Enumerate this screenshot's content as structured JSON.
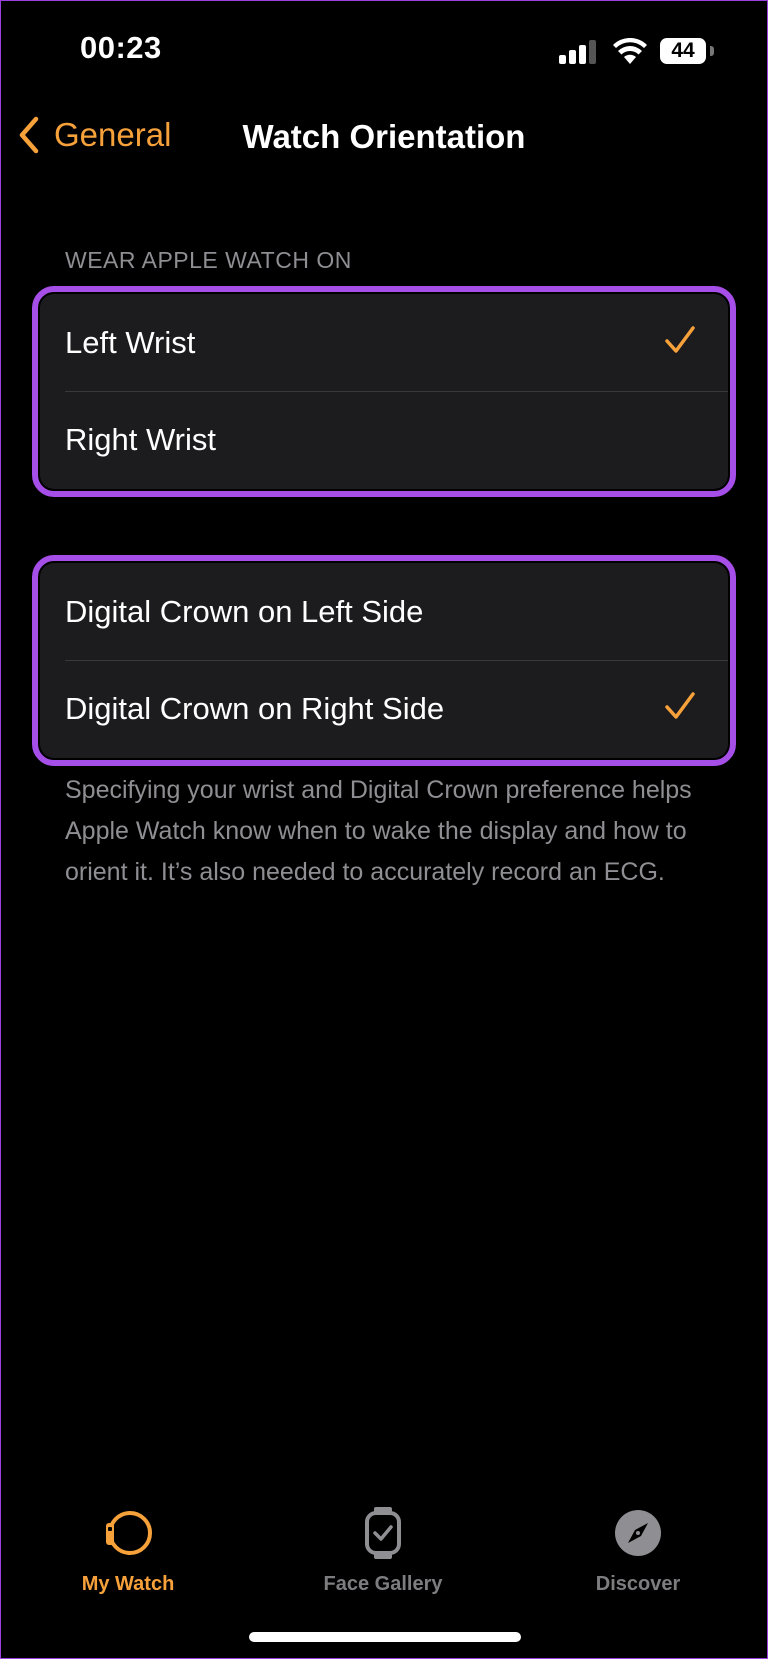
{
  "status_bar": {
    "time": "00:23",
    "battery": "44"
  },
  "nav": {
    "back_label": "General",
    "title": "Watch Orientation"
  },
  "section_header": "WEAR APPLE WATCH ON",
  "wrist_group": [
    {
      "label": "Left Wrist",
      "checked": true
    },
    {
      "label": "Right Wrist",
      "checked": false
    }
  ],
  "crown_group": [
    {
      "label": "Digital Crown on Left Side",
      "checked": false
    },
    {
      "label": "Digital Crown on Right Side",
      "checked": true
    }
  ],
  "footer": "Specifying your wrist and Digital Crown preference helps Apple Watch know when to wake the display and how to orient it. It’s also needed to accurately record an ECG.",
  "tabs": [
    {
      "label": "My Watch",
      "icon": "watch-icon",
      "active": true
    },
    {
      "label": "Face Gallery",
      "icon": "watch-face-icon",
      "active": false
    },
    {
      "label": "Discover",
      "icon": "compass-icon",
      "active": false
    }
  ],
  "colors": {
    "accent": "#f7a13b",
    "highlight": "#a54ee8",
    "background": "#000000",
    "cell": "#1c1c1e"
  }
}
